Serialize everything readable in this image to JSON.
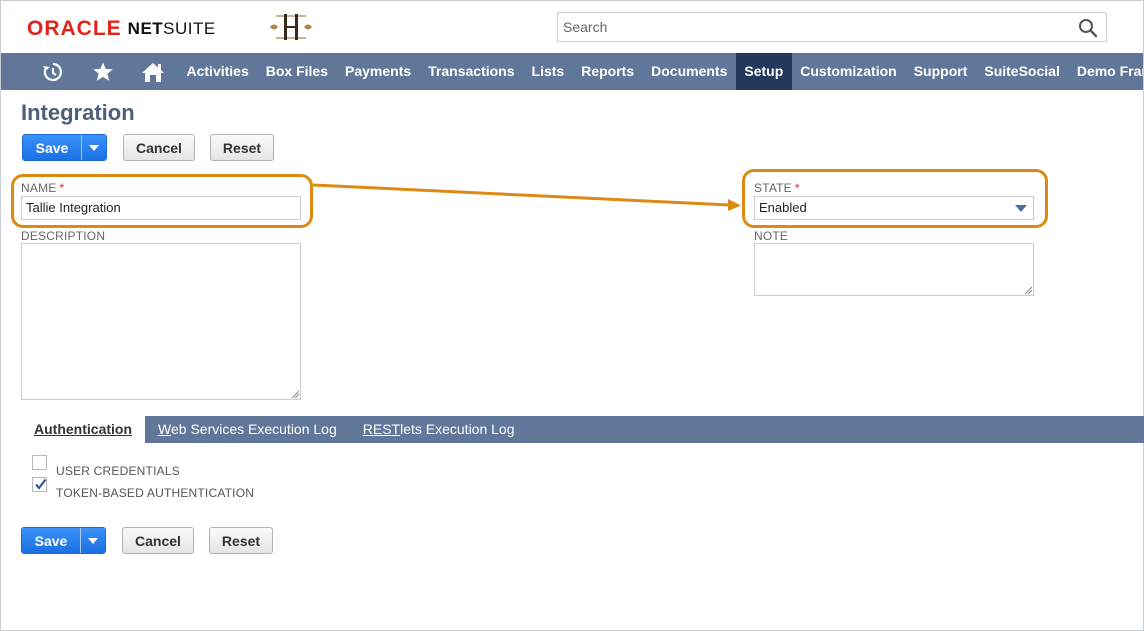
{
  "header": {
    "logo_oracle": "ORACLE",
    "logo_netsuite_bold": "NET",
    "logo_netsuite_rest": "SUITE",
    "search_placeholder": "Search"
  },
  "nav": {
    "icons": [
      "recent-records-icon",
      "star-icon",
      "home-icon"
    ],
    "items": [
      {
        "label": "Activities",
        "active": false
      },
      {
        "label": "Box Files",
        "active": false
      },
      {
        "label": "Payments",
        "active": false
      },
      {
        "label": "Transactions",
        "active": false
      },
      {
        "label": "Lists",
        "active": false
      },
      {
        "label": "Reports",
        "active": false
      },
      {
        "label": "Documents",
        "active": false
      },
      {
        "label": "Setup",
        "active": true
      },
      {
        "label": "Customization",
        "active": false
      },
      {
        "label": "Support",
        "active": false
      },
      {
        "label": "SuiteSocial",
        "active": false
      },
      {
        "label": "Demo Framework",
        "active": false
      }
    ]
  },
  "page": {
    "title": "Integration"
  },
  "buttons": {
    "save": "Save",
    "cancel": "Cancel",
    "reset": "Reset"
  },
  "form": {
    "name_label": "NAME",
    "name_value": "Tallie Integration",
    "description_label": "DESCRIPTION",
    "state_label": "STATE",
    "state_value": "Enabled",
    "note_label": "NOTE",
    "required_mark": "*"
  },
  "subtabs": {
    "items": [
      {
        "first": "A",
        "rest": "uthentication",
        "active": true
      },
      {
        "first": "W",
        "rest": "eb Services Execution Log",
        "active": false
      },
      {
        "first": "REST",
        "rest": "lets Execution Log",
        "active": false
      }
    ]
  },
  "auth": {
    "user_credentials_label": "USER CREDENTIALS",
    "user_credentials_checked": false,
    "token_based_label": "TOKEN-BASED AUTHENTICATION",
    "token_based_checked": true
  },
  "colors": {
    "nav_bg": "#607799",
    "nav_active": "#24385b",
    "highlight": "#dd8a14",
    "save_blue": "#1d7ef6",
    "oracle_red": "#e2231a"
  }
}
